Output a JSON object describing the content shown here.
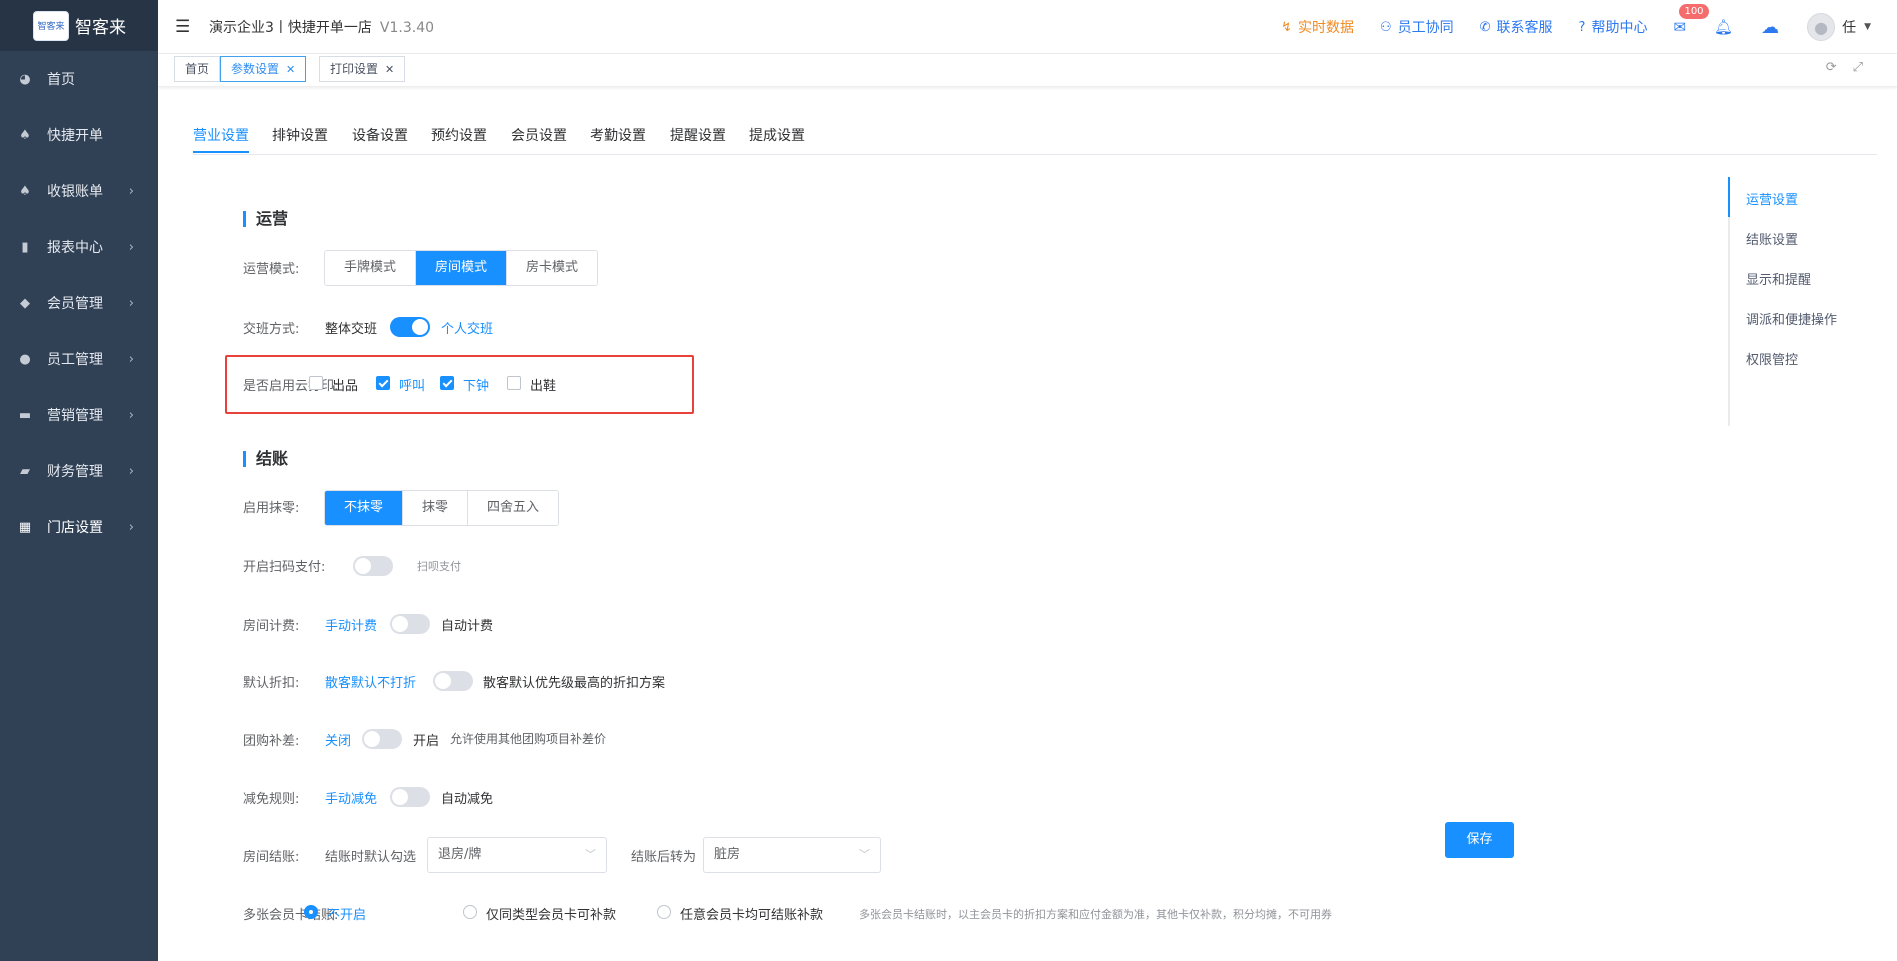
{
  "app": {
    "logo_text": "智客来",
    "logo_badge": "智客来"
  },
  "sidebar": {
    "items": [
      {
        "label": "首页",
        "icon": "dashboard-icon",
        "glyph": "◕",
        "has_arrow": false
      },
      {
        "label": "快捷开单",
        "icon": "money-bag-icon",
        "glyph": "♠",
        "has_arrow": false
      },
      {
        "label": "收银账单",
        "icon": "money-bag-icon",
        "glyph": "♠",
        "has_arrow": true
      },
      {
        "label": "报表中心",
        "icon": "bar-chart-icon",
        "glyph": "▮",
        "has_arrow": true
      },
      {
        "label": "会员管理",
        "icon": "diamond-icon",
        "glyph": "◆",
        "has_arrow": true
      },
      {
        "label": "员工管理",
        "icon": "user-icon",
        "glyph": "●",
        "has_arrow": true
      },
      {
        "label": "营销管理",
        "icon": "briefcase-icon",
        "glyph": "▬",
        "has_arrow": true
      },
      {
        "label": "财务管理",
        "icon": "wallet-icon",
        "glyph": "▰",
        "has_arrow": true
      },
      {
        "label": "门店设置",
        "icon": "grid-icon",
        "glyph": "▦",
        "has_arrow": true
      }
    ]
  },
  "header": {
    "title": "演示企业3丨快捷开单一店",
    "version": "V1.3.40",
    "nav": [
      {
        "label": "实时数据",
        "icon": "realtime-icon",
        "glyph": "↯",
        "color": "#f08a24"
      },
      {
        "label": "员工协同",
        "icon": "team-icon",
        "glyph": "⚇",
        "color": "#2d79f0"
      },
      {
        "label": "联系客服",
        "icon": "phone-icon",
        "glyph": "✆",
        "color": "#2d79f0"
      },
      {
        "label": "帮助中心",
        "icon": "help-icon",
        "glyph": "?",
        "color": "#2d79f0"
      }
    ],
    "mail_badge": "100",
    "user_name": "任"
  },
  "tags": [
    {
      "label": "首页",
      "closable": false,
      "active": false
    },
    {
      "label": "参数设置",
      "closable": true,
      "active": true
    },
    {
      "label": "打印设置",
      "closable": true,
      "active": false
    }
  ],
  "tabs": [
    "营业设置",
    "排钟设置",
    "设备设置",
    "预约设置",
    "会员设置",
    "考勤设置",
    "提醒设置",
    "提成设置"
  ],
  "operation": {
    "section_title": "运营",
    "mode_label": "运营模式:",
    "modes": [
      "手牌模式",
      "房间模式",
      "房卡模式"
    ],
    "selected_mode": "房间模式",
    "handover_label": "交班方式:",
    "handover_off": "整体交班",
    "handover_on": "个人交班",
    "handover_enabled": true,
    "cloud_print_label": "是否启用云打印:",
    "cloud_print": [
      {
        "label": "出品",
        "checked": false
      },
      {
        "label": "呼叫",
        "checked": true
      },
      {
        "label": "下钟",
        "checked": true
      },
      {
        "label": "出鞋",
        "checked": false
      }
    ]
  },
  "checkout": {
    "section_title": "结账",
    "rounding_label": "启用抹零:",
    "rounding_options": [
      "不抹零",
      "抹零",
      "四舍五入"
    ],
    "rounding_selected": "不抹零",
    "scan_label": "开启扫码支付:",
    "scan_hint": "扫呗支付",
    "scan_enabled": false,
    "room_fee_label": "房间计费:",
    "room_fee_left": "手动计费",
    "room_fee_right": "自动计费",
    "room_fee_enabled": false,
    "discount_label": "默认折扣:",
    "discount_left": "散客默认不打折",
    "discount_right": "散客默认优先级最高的折扣方案",
    "discount_enabled": false,
    "group_label": "团购补差:",
    "group_left": "关闭",
    "group_right": "开启",
    "group_hint": "允许使用其他团购项目补差价",
    "group_enabled": false,
    "waive_label": "减免规则:",
    "waive_left": "手动减免",
    "waive_right": "自动减免",
    "waive_enabled": false,
    "room_checkout_label": "房间结账:",
    "default_check_label": "结账时默认勾选",
    "default_check_value": "退房/牌",
    "after_checkout_label": "结账后转为",
    "after_checkout_value": "脏房",
    "multi_card_label": "多张会员卡结账:",
    "multi_card_options": [
      "不开启",
      "仅同类型会员卡可补款",
      "任意会员卡均可结账补款"
    ],
    "multi_card_selected": "不开启",
    "multi_card_hint": "多张会员卡结账时，以主会员卡的折扣方案和应付金额为准，其他卡仅补款，积分均摊，不可用券"
  },
  "save_label": "保存",
  "anchors": [
    "运营设置",
    "结账设置",
    "显示和提醒",
    "调派和便捷操作",
    "权限管控"
  ],
  "anchor_active": "运营设置",
  "colors": {
    "primary": "#1890ff",
    "sidebar": "#304156",
    "highlight_box": "#e8413c"
  }
}
